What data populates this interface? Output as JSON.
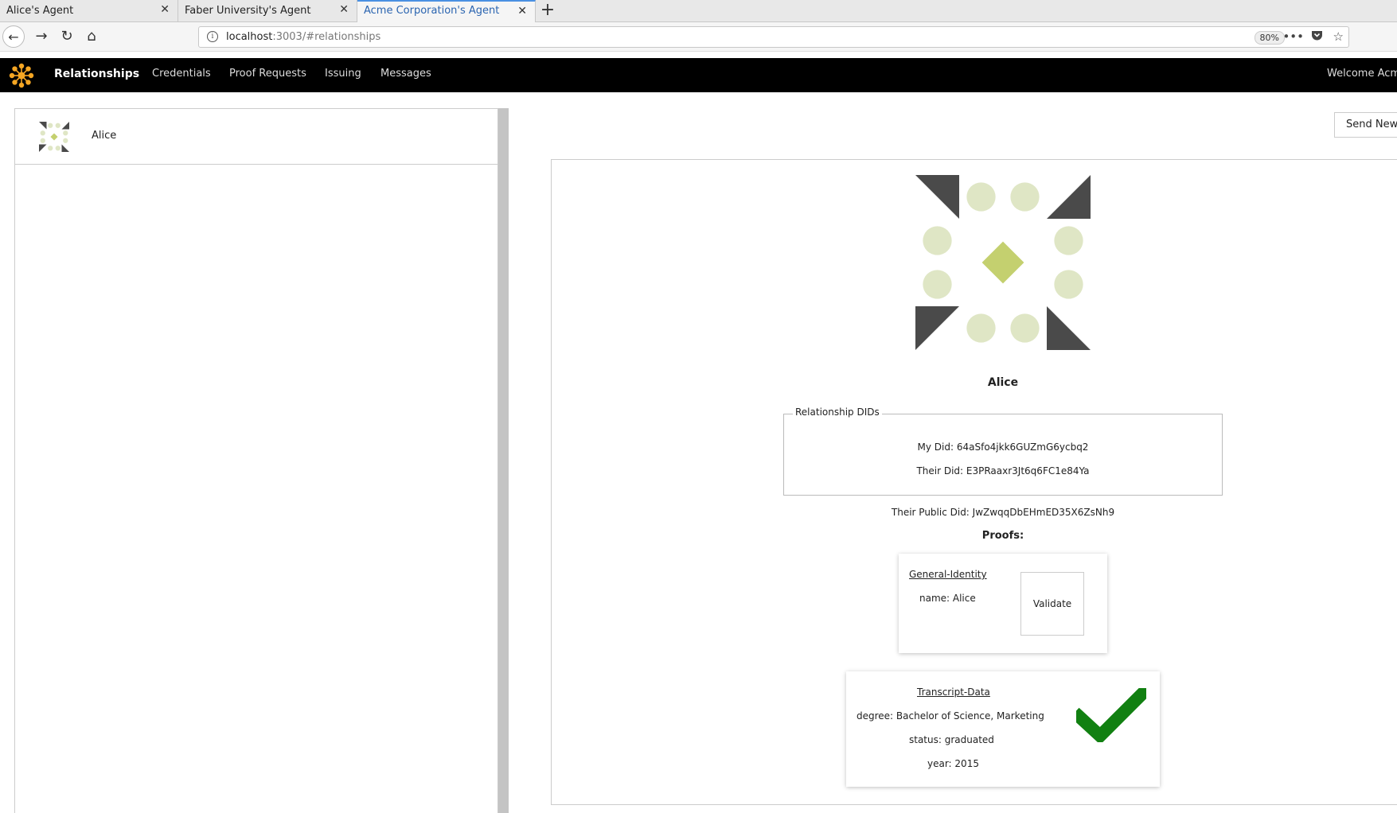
{
  "browser": {
    "tabs": [
      {
        "title": "Alice's Agent",
        "active": false
      },
      {
        "title": "Faber University's Agent",
        "active": false
      },
      {
        "title": "Acme Corporation's Agent",
        "active": true
      }
    ],
    "url_host": "localhost",
    "url_rest": ":3003/#relationships",
    "zoom": "80%"
  },
  "app": {
    "nav": [
      {
        "label": "Relationships",
        "active": true
      },
      {
        "label": "Credentials",
        "active": false
      },
      {
        "label": "Proof Requests",
        "active": false
      },
      {
        "label": "Issuing",
        "active": false
      },
      {
        "label": "Messages",
        "active": false
      }
    ],
    "welcome": "Welcome Acme",
    "brand_color": "#f5a623"
  },
  "sidebar": {
    "relationships": [
      {
        "name": "Alice"
      }
    ]
  },
  "toolbar": {
    "send_new_label": "Send New"
  },
  "detail": {
    "name": "Alice",
    "dids_legend": "Relationship DIDs",
    "my_did": "My Did: 64aSfo4jkk6GUZmG6ycbq2",
    "their_did": "Their Did: E3PRaaxr3Jt6q6FC1e84Ya",
    "their_public_did": "Their Public Did: JwZwqqDbEHmED35X6ZsNh9",
    "proofs_title": "Proofs:",
    "proofs": [
      {
        "name": "General-Identity",
        "attributes": [
          "name: Alice"
        ],
        "action_label": "Validate",
        "validated": false
      },
      {
        "name": "Transcript-Data",
        "attributes": [
          "degree: Bachelor of Science, Marketing",
          "status: graduated",
          "year: 2015"
        ],
        "validated": true
      }
    ],
    "colors": {
      "identicon_dark": "#4a4a4a",
      "identicon_light": "#dfe6c5",
      "identicon_accent": "#c4d06f",
      "check": "#118011"
    }
  }
}
